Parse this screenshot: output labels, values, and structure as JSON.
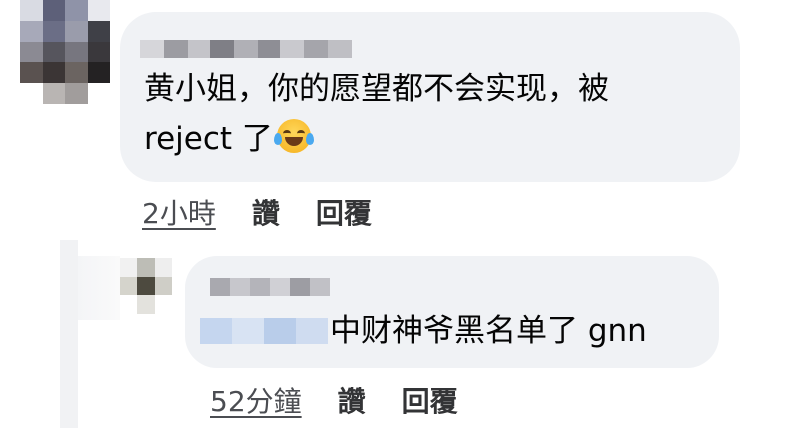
{
  "comment": {
    "text_line1": "黄小姐，你的愿望都不会实现，被",
    "text_line2": "reject 了",
    "emoji_icon": "face-with-tears-of-joy-icon",
    "timestamp": "2小時",
    "like_label": "讚",
    "reply_label": "回覆"
  },
  "reply": {
    "text": "中财神爷黑名单了 gnn",
    "timestamp": "52分鐘",
    "like_label": "讚",
    "reply_label": "回覆"
  },
  "colors": {
    "bubble_bg": "#f0f2f5",
    "text": "#050505",
    "meta_text": "#4b4d52"
  }
}
